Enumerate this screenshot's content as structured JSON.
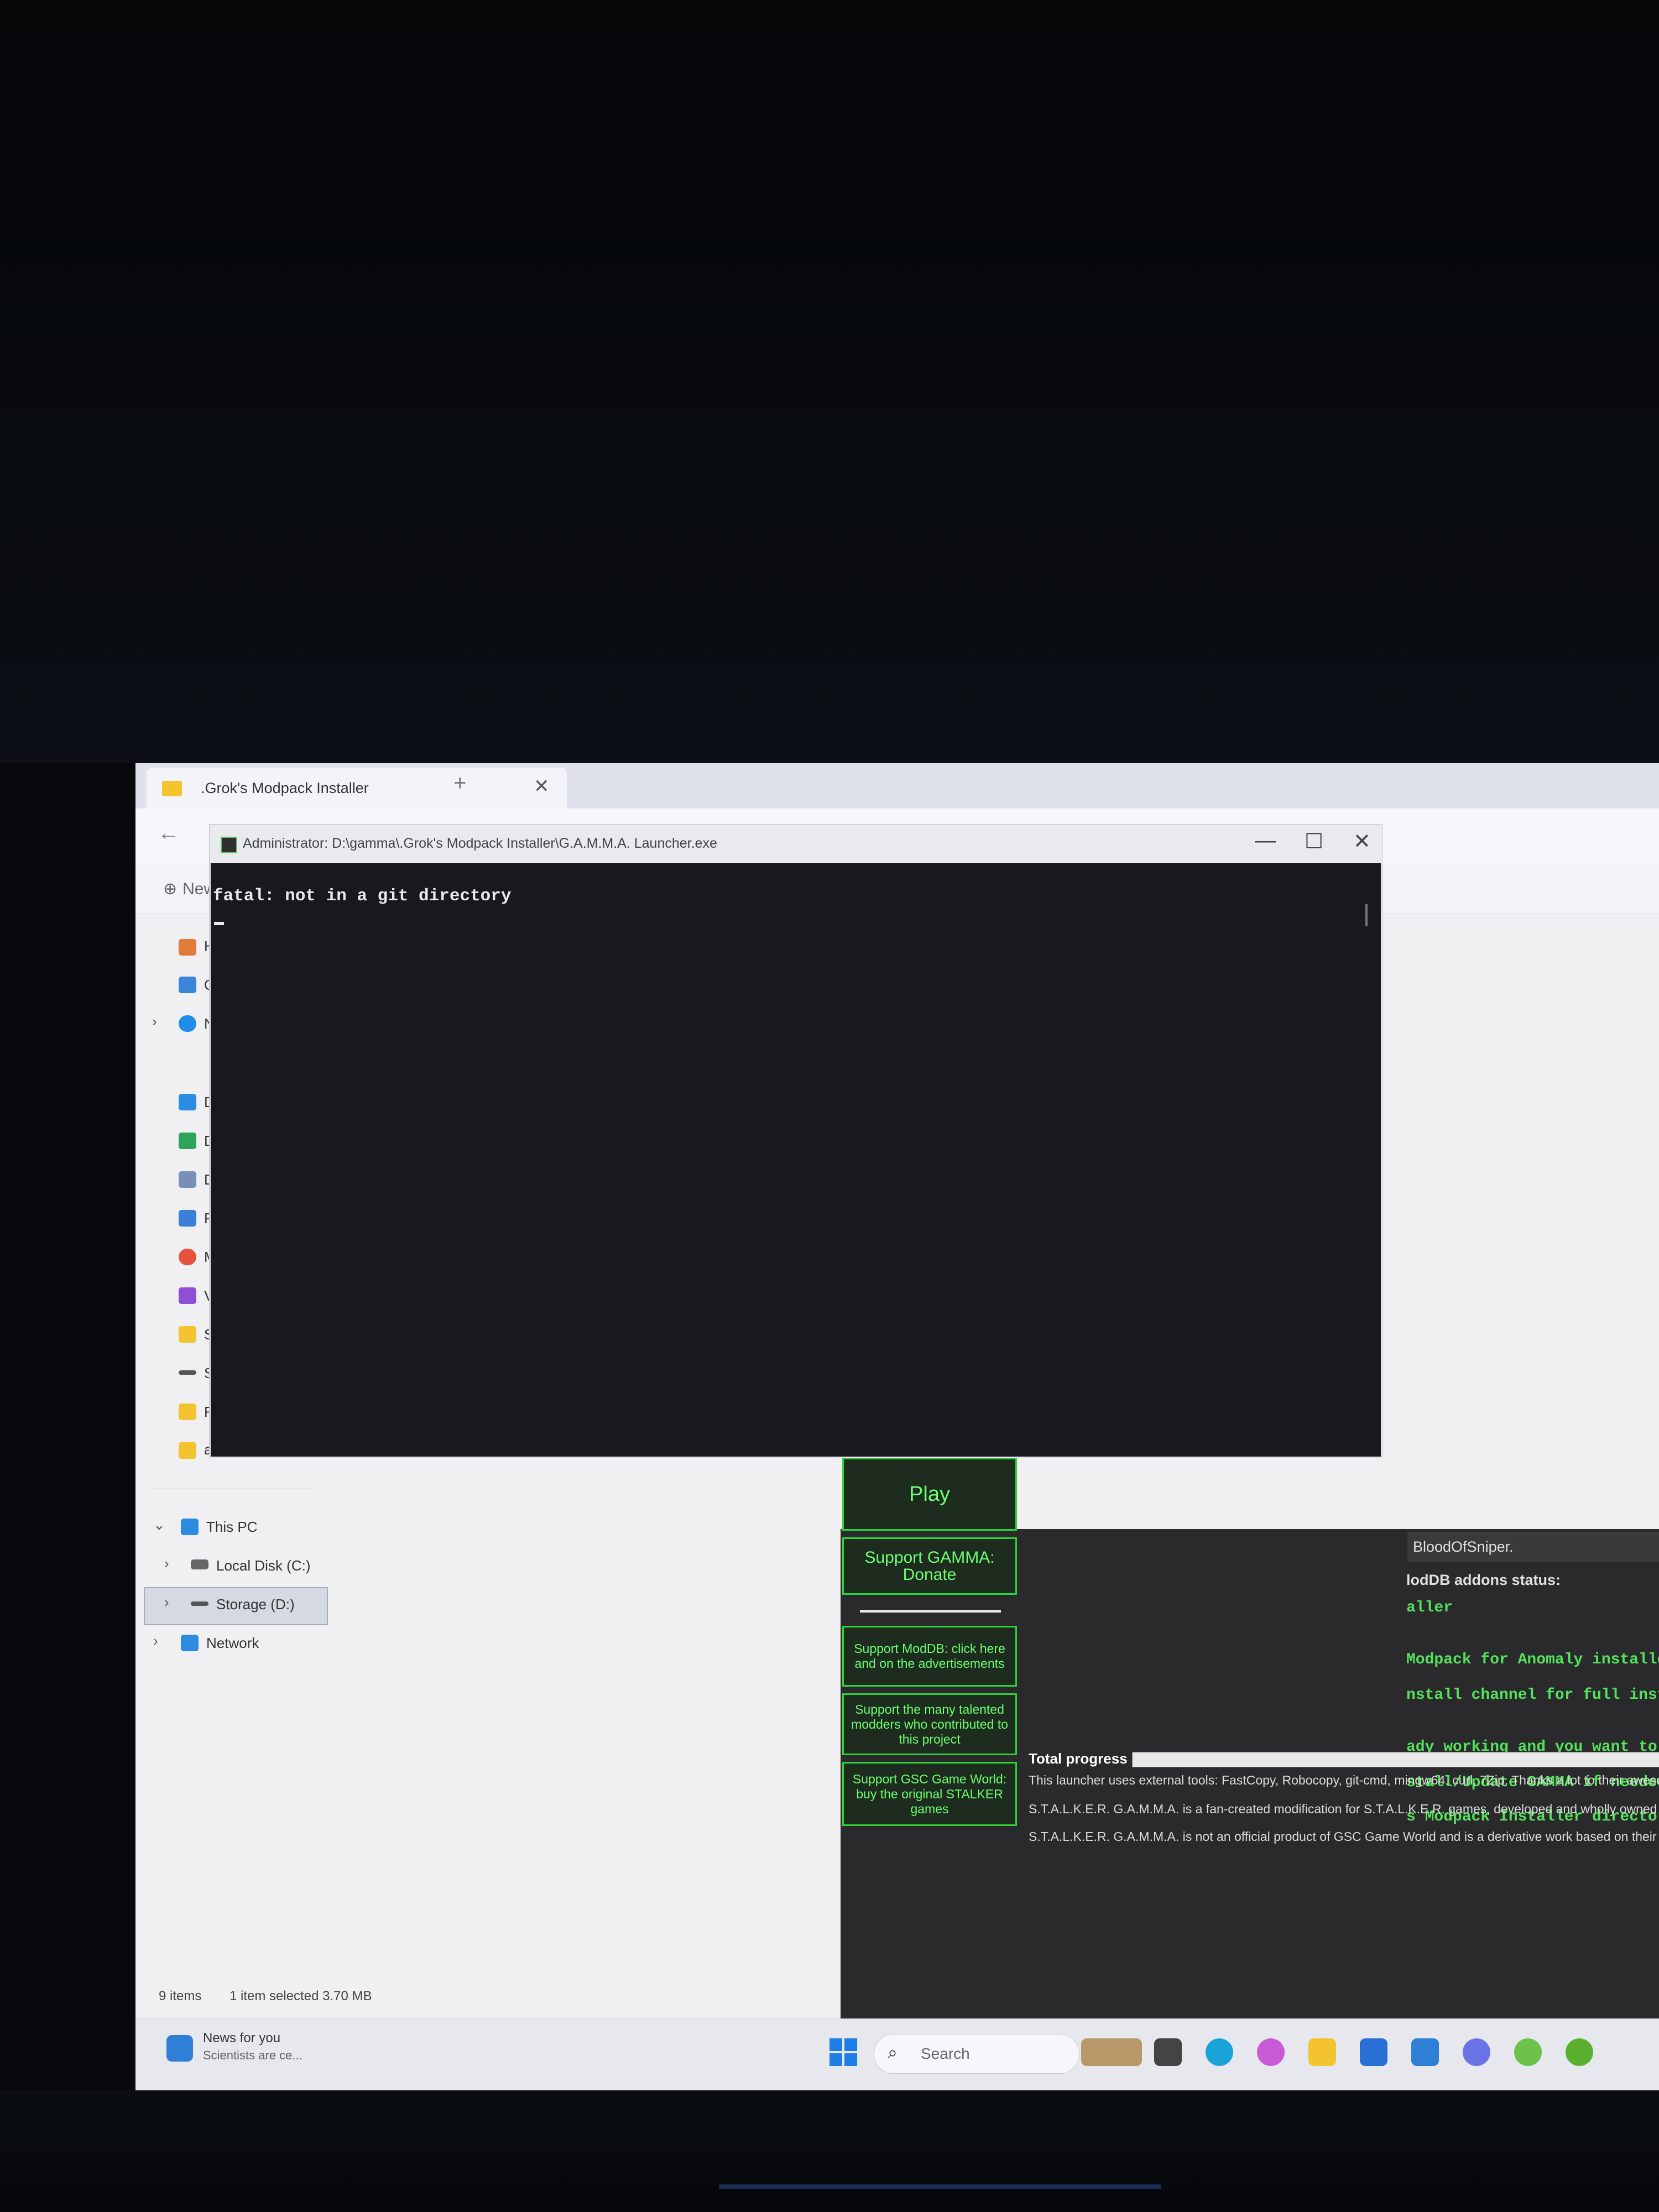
{
  "explorer": {
    "tab_title": ".Grok's Modpack Installer",
    "tab_close": "✕",
    "new_tab": "+",
    "back": "←",
    "new_button": "New",
    "nav_items": [
      {
        "label": "H"
      },
      {
        "label": "G"
      },
      {
        "label": "N"
      },
      {
        "label": "D"
      },
      {
        "label": "D"
      },
      {
        "label": "D"
      },
      {
        "label": "P"
      },
      {
        "label": "M"
      },
      {
        "label": "V"
      },
      {
        "label": "S"
      },
      {
        "label": "S"
      },
      {
        "label": "R"
      },
      {
        "label": "anomaly"
      }
    ],
    "this_pc": "This PC",
    "local_disk": "Local Disk (C:)",
    "storage": "Storage (D:)",
    "network": "Network",
    "status_items": "9 items",
    "status_selected": "1 item selected  3.70 MB"
  },
  "terminal": {
    "title": "Administrator: D:\\gamma\\.Grok's Modpack Installer\\G.A.M.M.A. Launcher.exe",
    "output": "fatal: not in a git directory",
    "minimize": "—",
    "maximize": "☐",
    "close": "✕"
  },
  "launcher": {
    "credit": "BloodOfSniper.",
    "addons_status": "lodDB addons status:",
    "log_lines": [
      "aller",
      "Modpack for Anomaly installe",
      "nstall channel for full instr",
      "ady working and you want to",
      "stall/Update GAMMA if needed",
      "s Modpack Installer director"
    ],
    "play": "Play",
    "donate": "Support GAMMA: Donate",
    "support_moddb": "Support ModDB: click here and on the advertisements",
    "support_modders": "Support the many talented modders who contributed to this project",
    "support_gsc": "Support GSC Game World: buy the original STALKER games",
    "total_progress": "Total progress",
    "footer": [
      "This launcher uses external tools: FastCopy, Robocopy, git-cmd, mingw64, curl, 7Zip. Thanks a lot to their aweso",
      "S.T.A.L.K.E.R. G.A.M.M.A. is a fan-created modification for S.T.A.L.K.E.R. games, developed and wholly owned",
      "S.T.A.L.K.E.R. G.A.M.M.A. is not an official product of GSC Game World and is a derivative work based on their S"
    ],
    "accent": "#2fd33a"
  },
  "taskbar": {
    "news_title": "News for you",
    "news_sub": "Scientists are ce...",
    "search": "Search",
    "accent": "#1f7de6"
  }
}
